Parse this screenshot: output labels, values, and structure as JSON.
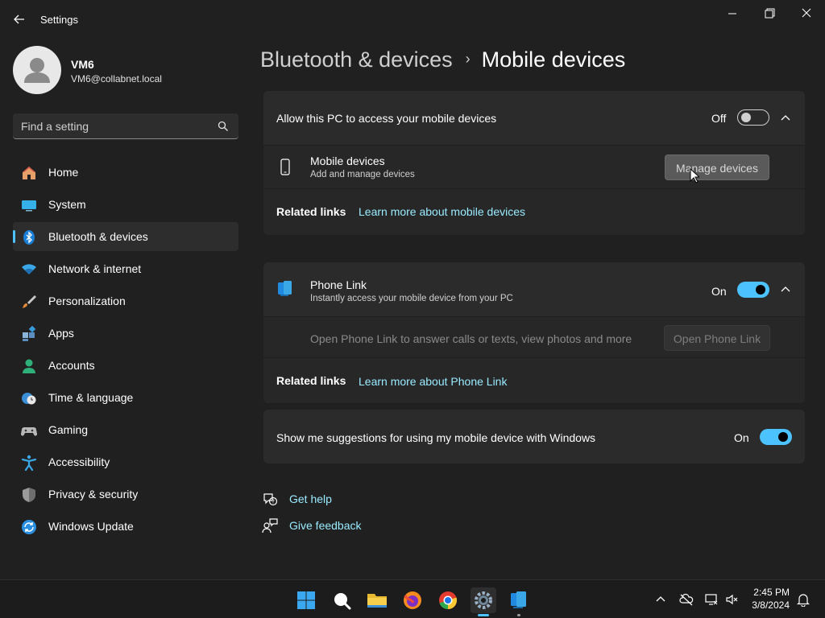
{
  "window": {
    "title": "Settings"
  },
  "user": {
    "name": "VM6",
    "email": "VM6@collabnet.local"
  },
  "search": {
    "placeholder": "Find a setting"
  },
  "sidebar": {
    "items": [
      {
        "label": "Home",
        "icon": "home-icon"
      },
      {
        "label": "System",
        "icon": "system-icon"
      },
      {
        "label": "Bluetooth & devices",
        "icon": "bluetooth-icon",
        "active": true
      },
      {
        "label": "Network & internet",
        "icon": "wifi-icon"
      },
      {
        "label": "Personalization",
        "icon": "brush-icon"
      },
      {
        "label": "Apps",
        "icon": "apps-icon"
      },
      {
        "label": "Accounts",
        "icon": "accounts-icon"
      },
      {
        "label": "Time & language",
        "icon": "clock-globe-icon"
      },
      {
        "label": "Gaming",
        "icon": "gamepad-icon"
      },
      {
        "label": "Accessibility",
        "icon": "accessibility-icon"
      },
      {
        "label": "Privacy & security",
        "icon": "shield-icon"
      },
      {
        "label": "Windows Update",
        "icon": "update-icon"
      }
    ]
  },
  "header": {
    "parent": "Bluetooth & devices",
    "separator": "›",
    "current": "Mobile devices"
  },
  "mobile_access": {
    "title": "Allow this PC to access your mobile devices",
    "state_label": "Off",
    "enabled": false,
    "device_row": {
      "title": "Mobile devices",
      "description": "Add and manage devices",
      "button": "Manage devices"
    },
    "related_label": "Related links",
    "related_link": "Learn more about mobile devices"
  },
  "phone_link": {
    "title": "Phone Link",
    "description": "Instantly access your mobile device from your PC",
    "state_label": "On",
    "enabled": true,
    "open_text": "Open Phone Link to answer calls or texts, view photos and more",
    "open_button": "Open Phone Link",
    "related_label": "Related links",
    "related_link": "Learn more about Phone Link"
  },
  "suggestions": {
    "title": "Show me suggestions for using my mobile device with Windows",
    "state_label": "On",
    "enabled": true
  },
  "footer_links": {
    "help": "Get help",
    "feedback": "Give feedback"
  },
  "taskbar": {
    "apps": [
      "start-icon",
      "search-icon",
      "file-explorer-icon",
      "firefox-icon",
      "chrome-icon",
      "settings-icon",
      "phone-link-icon"
    ],
    "time": "2:45 PM",
    "date": "3/8/2024"
  },
  "colors": {
    "accent": "#4cc2ff",
    "link": "#99ebff",
    "background": "#202020",
    "card": "#2b2b2b"
  }
}
